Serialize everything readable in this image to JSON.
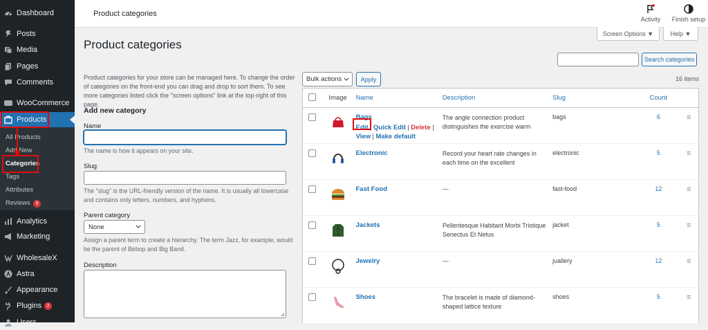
{
  "sidebar": {
    "items": [
      {
        "label": "Dashboard",
        "icon": "dashboard-icon"
      },
      {
        "label": "Posts",
        "icon": "pin-icon"
      },
      {
        "label": "Media",
        "icon": "media-icon"
      },
      {
        "label": "Pages",
        "icon": "pages-icon"
      },
      {
        "label": "Comments",
        "icon": "comments-icon"
      },
      {
        "label": "WooCommerce",
        "icon": "woocommerce-icon"
      },
      {
        "label": "Products",
        "icon": "products-icon"
      },
      {
        "label": "Analytics",
        "icon": "analytics-icon"
      },
      {
        "label": "Marketing",
        "icon": "megaphone-icon"
      },
      {
        "label": "WholesaleX",
        "icon": "wholesalex-icon"
      },
      {
        "label": "Astra",
        "icon": "astra-icon"
      },
      {
        "label": "Appearance",
        "icon": "brush-icon"
      },
      {
        "label": "Plugins",
        "icon": "plug-icon",
        "badge": "2"
      },
      {
        "label": "Users",
        "icon": "users-icon"
      }
    ],
    "submenu": [
      {
        "label": "All Products"
      },
      {
        "label": "Add New"
      },
      {
        "label": "Categories"
      },
      {
        "label": "Tags"
      },
      {
        "label": "Attributes"
      },
      {
        "label": "Reviews",
        "badge": "9"
      }
    ]
  },
  "topbar": {
    "title": "Product categories",
    "activity": "Activity",
    "finish_setup": "Finish setup",
    "screen_options": "Screen Options ▼",
    "help": "Help ▼"
  },
  "page": {
    "heading": "Product categories",
    "intro": "Product categories for your store can be managed here. To change the order of categories on the front-end you can drag and drop to sort them. To see more categories listed click the \"screen options\" link at the top-right of this page.",
    "add_new_title": "Add new category",
    "name_label": "Name",
    "name_hint": "The name is how it appears on your site.",
    "slug_label": "Slug",
    "slug_hint": "The \"slug\" is the URL-friendly version of the name. It is usually all lowercase and contains only letters, numbers, and hyphens.",
    "parent_label": "Parent category",
    "parent_value": "None",
    "parent_hint": "Assign a parent term to create a hierarchy. The term Jazz, for example, would be the parent of Bebop and Big Band.",
    "description_label": "Description"
  },
  "list": {
    "bulk_actions": "Bulk actions",
    "apply": "Apply",
    "search_button": "Search categories",
    "count_text": "16 items",
    "columns": {
      "image": "Image",
      "name": "Name",
      "description": "Description",
      "slug": "Slug",
      "count": "Count"
    },
    "row_actions": {
      "edit": "Edit",
      "quick_edit": "Quick Edit",
      "delete": "Delete",
      "view": "View",
      "make_default": "Make default"
    },
    "rows": [
      {
        "name": "Bags",
        "description": "The angle connection product distinguishes the exercise warm",
        "slug": "bags",
        "count": "6",
        "thumb": "bag-icon"
      },
      {
        "name": "Electronic",
        "description": "Record your heart rate changes in each time on the excellent",
        "slug": "electronic",
        "count": "5",
        "thumb": "headphones-icon"
      },
      {
        "name": "Fast Food",
        "description": "—",
        "slug": "fast-food",
        "count": "12",
        "thumb": "burger-icon"
      },
      {
        "name": "Jackets",
        "description": "Pellentesque Habitant Morbi Tristique Senectus Et Netus",
        "slug": "jacket",
        "count": "5",
        "thumb": "jacket-icon"
      },
      {
        "name": "Jewelry",
        "description": "—",
        "slug": "juallery",
        "count": "12",
        "thumb": "necklace-icon"
      },
      {
        "name": "Shoes",
        "description": "The bracelet is made of diamond-shaped lattice texture",
        "slug": "shoes",
        "count": "5",
        "thumb": "shoe-icon"
      }
    ]
  },
  "colors": {
    "sidebar": "#1d2327",
    "accent": "#2271b1",
    "highlight": "#e20b0b"
  }
}
